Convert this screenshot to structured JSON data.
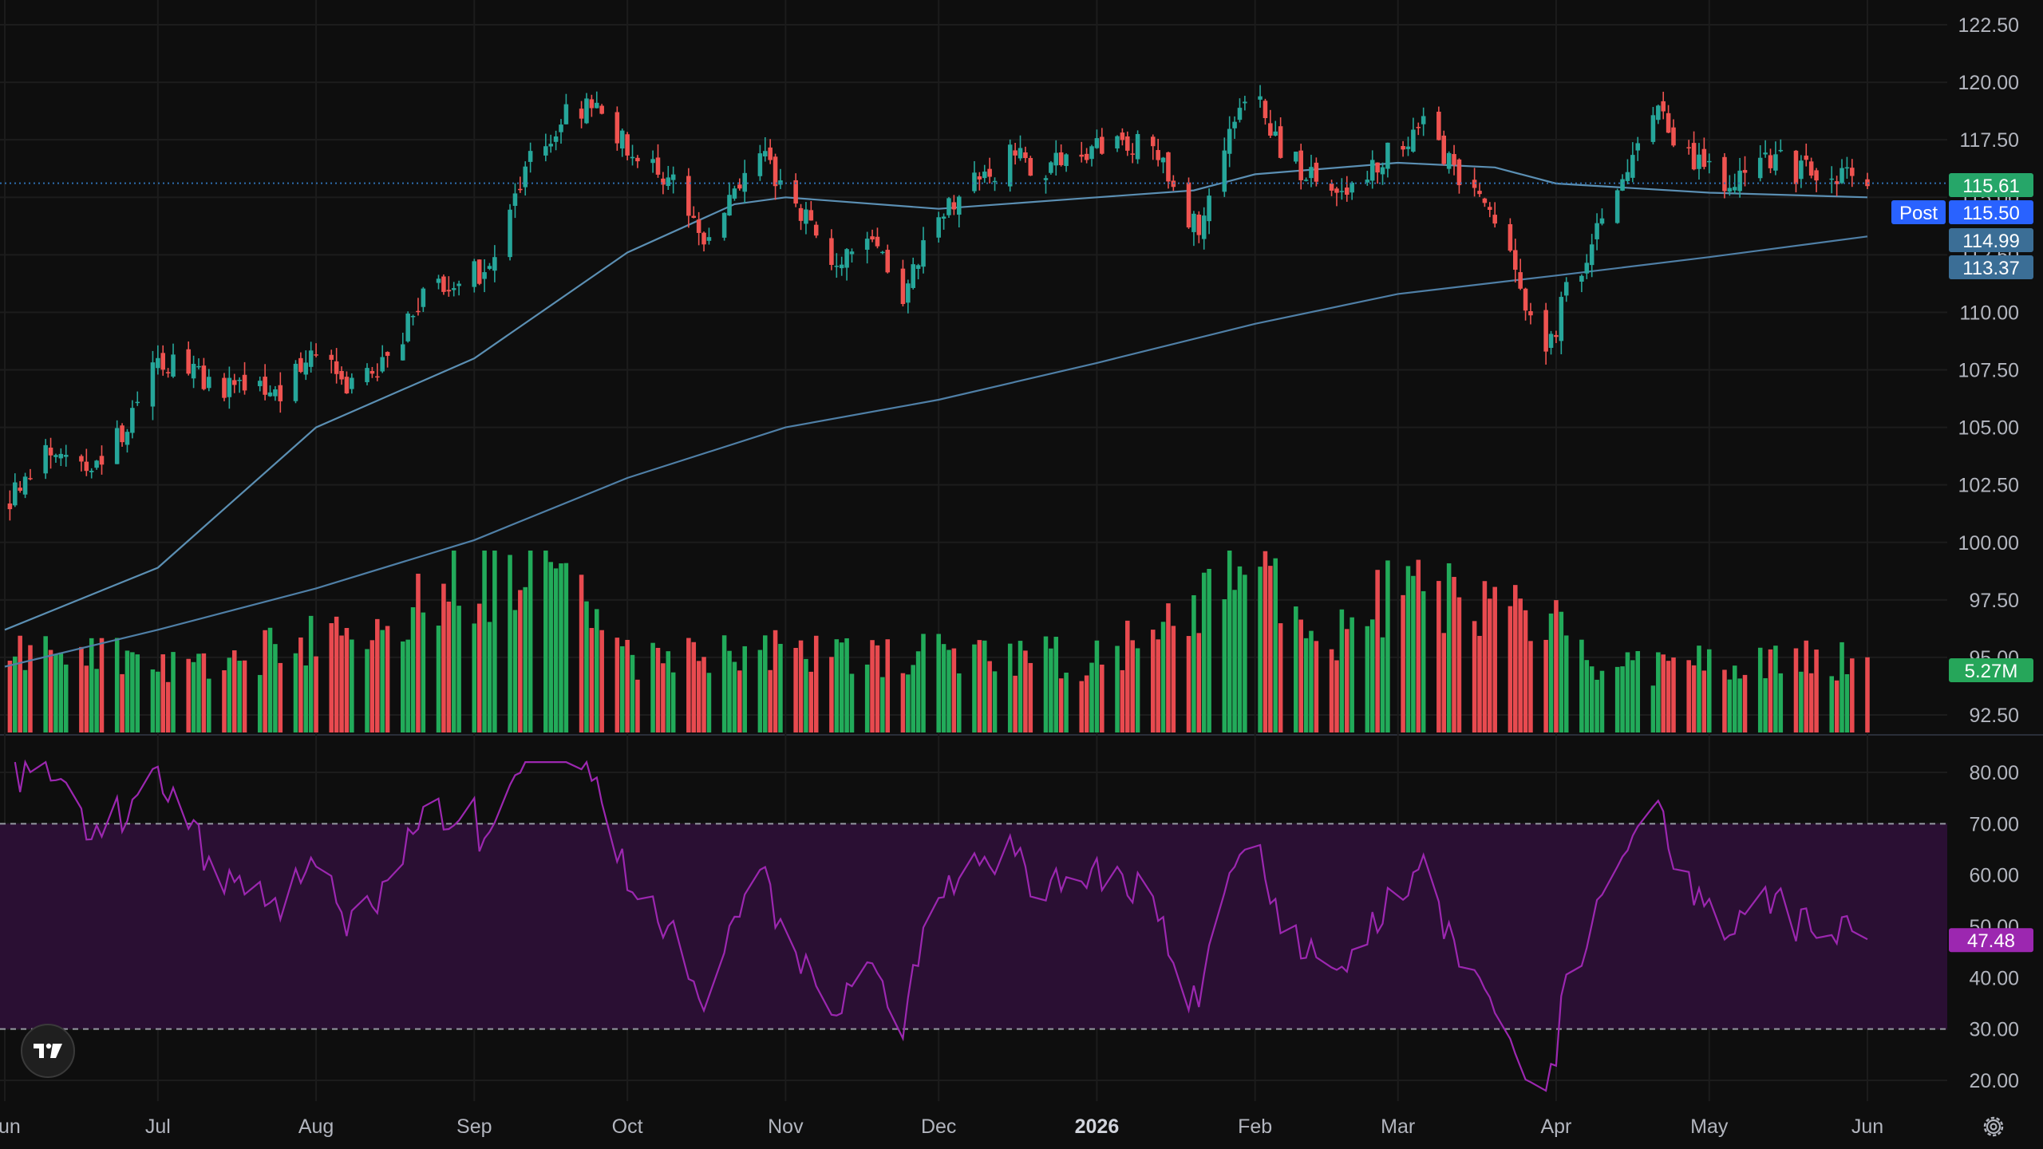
{
  "chart_data": [
    {
      "type": "candlestick",
      "panel": "price",
      "y_axis_ticks": [
        "122.50",
        "120.00",
        "117.50",
        "115.00",
        "112.50",
        "110.00",
        "107.50",
        "105.00",
        "102.50",
        "100.00",
        "97.50",
        "95.00",
        "92.50"
      ],
      "ylim": [
        91.8,
        123.5
      ],
      "grid": true,
      "x_axis_labels": [
        "un",
        "Jul",
        "Aug",
        "Sep",
        "Oct",
        "Nov",
        "Dec",
        "2026",
        "Feb",
        "Mar",
        "Apr",
        "May",
        "Jun"
      ],
      "close_anchors": [
        [
          "2025-06-02",
          102.0
        ],
        [
          "2025-06-10",
          104.2
        ],
        [
          "2025-06-18",
          103.5
        ],
        [
          "2025-06-25",
          104.8
        ],
        [
          "2025-07-01",
          108.0
        ],
        [
          "2025-07-08",
          107.3
        ],
        [
          "2025-07-16",
          106.6
        ],
        [
          "2025-07-24",
          106.4
        ],
        [
          "2025-08-01",
          108.1
        ],
        [
          "2025-08-08",
          106.7
        ],
        [
          "2025-08-15",
          107.8
        ],
        [
          "2025-08-22",
          110.7
        ],
        [
          "2025-08-29",
          111.2
        ],
        [
          "2025-09-05",
          112.3
        ],
        [
          "2025-09-12",
          116.5
        ],
        [
          "2025-09-18",
          118.5
        ],
        [
          "2025-09-25",
          118.8
        ],
        [
          "2025-10-03",
          116.6
        ],
        [
          "2025-10-10",
          115.5
        ],
        [
          "2025-10-16",
          113.2
        ],
        [
          "2025-10-22",
          115.6
        ],
        [
          "2025-10-28",
          116.8
        ],
        [
          "2025-11-03",
          114.5
        ],
        [
          "2025-11-10",
          112.4
        ],
        [
          "2025-11-17",
          113.2
        ],
        [
          "2025-11-24",
          110.6
        ],
        [
          "2025-12-01",
          114.2
        ],
        [
          "2025-12-08",
          115.6
        ],
        [
          "2025-12-15",
          116.8
        ],
        [
          "2025-12-22",
          116.3
        ],
        [
          "2025-12-29",
          116.9
        ],
        [
          "2026-01-05",
          117.6
        ],
        [
          "2026-01-12",
          117.2
        ],
        [
          "2026-01-16",
          115.2
        ],
        [
          "2026-01-21",
          113.6
        ],
        [
          "2026-01-26",
          117.6
        ],
        [
          "2026-02-01",
          119.5
        ],
        [
          "2026-02-06",
          117.0
        ],
        [
          "2026-02-12",
          116.0
        ],
        [
          "2026-02-18",
          114.8
        ],
        [
          "2026-02-25",
          116.6
        ],
        [
          "2026-03-03",
          117.5
        ],
        [
          "2026-03-06",
          118.3
        ],
        [
          "2026-03-12",
          116.4
        ],
        [
          "2026-03-18",
          114.5
        ],
        [
          "2026-03-24",
          111.8
        ],
        [
          "2026-03-30",
          107.9
        ],
        [
          "2026-04-03",
          110.8
        ],
        [
          "2026-04-09",
          113.4
        ],
        [
          "2026-04-15",
          116.0
        ],
        [
          "2026-04-21",
          119.0
        ],
        [
          "2026-04-27",
          116.7
        ],
        [
          "2026-05-04",
          115.6
        ],
        [
          "2026-05-11",
          117.0
        ],
        [
          "2026-05-18",
          116.1
        ],
        [
          "2026-05-25",
          116.2
        ],
        [
          "2026-06-01",
          115.5
        ]
      ],
      "moving_averages": [
        {
          "period": 50,
          "color": "#5b8fb3",
          "points": [
            [
              "2025-06-01",
              96.2
            ],
            [
              "2025-07-01",
              98.9
            ],
            [
              "2025-08-01",
              105.0
            ],
            [
              "2025-09-01",
              108.0
            ],
            [
              "2025-10-01",
              112.6
            ],
            [
              "2025-10-22",
              114.7
            ],
            [
              "2025-11-01",
              115.0
            ],
            [
              "2025-12-01",
              114.5
            ],
            [
              "2026-01-01",
              115.0
            ],
            [
              "2026-01-20",
              115.3
            ],
            [
              "2026-02-01",
              116.0
            ],
            [
              "2026-03-01",
              116.5
            ],
            [
              "2026-03-20",
              116.3
            ],
            [
              "2026-04-01",
              115.6
            ],
            [
              "2026-05-01",
              115.2
            ],
            [
              "2026-06-01",
              115.0
            ]
          ]
        },
        {
          "period": 200,
          "color": "#4f7fa6",
          "points": [
            [
              "2025-06-01",
              94.6
            ],
            [
              "2025-07-01",
              96.2
            ],
            [
              "2025-08-01",
              98.0
            ],
            [
              "2025-09-01",
              100.1
            ],
            [
              "2025-10-01",
              102.8
            ],
            [
              "2025-11-01",
              105.0
            ],
            [
              "2025-12-01",
              106.2
            ],
            [
              "2026-01-01",
              107.8
            ],
            [
              "2026-02-01",
              109.5
            ],
            [
              "2026-03-01",
              110.8
            ],
            [
              "2026-04-01",
              111.6
            ],
            [
              "2026-05-01",
              112.4
            ],
            [
              "2026-06-01",
              113.3
            ]
          ]
        }
      ],
      "price_labels": [
        {
          "text": "115.61",
          "value": 115.61,
          "kind": "last",
          "color": "#26a669"
        },
        {
          "text": "115.50",
          "value": 115.5,
          "kind": "post",
          "color": "#2962ff",
          "tag": "Post"
        },
        {
          "text": "114.99",
          "value": 114.99,
          "kind": "ma50",
          "color": "#3b6e96"
        },
        {
          "text": "113.37",
          "value": 113.37,
          "kind": "ma200",
          "color": "#3b6e96"
        }
      ],
      "up_color": "#26a69a",
      "down_color": "#ef5350"
    },
    {
      "type": "bar",
      "panel": "volume",
      "last_volume_label": "5.27M",
      "label_color": "#26a65a",
      "relative_volume_note": "bar heights relative (0-1) to the tallest bar",
      "relative_volume_anchors": [
        [
          "2025-06-02",
          0.42
        ],
        [
          "2025-07-15",
          0.38
        ],
        [
          "2025-08-12",
          0.62
        ],
        [
          "2025-09-15",
          0.95
        ],
        [
          "2025-10-01",
          0.4
        ],
        [
          "2025-11-01",
          0.45
        ],
        [
          "2025-12-01",
          0.42
        ],
        [
          "2026-01-01",
          0.4
        ],
        [
          "2026-01-20",
          0.7
        ],
        [
          "2026-02-01",
          0.92
        ],
        [
          "2026-02-15",
          0.45
        ],
        [
          "2026-03-01",
          0.8
        ],
        [
          "2026-03-20",
          0.72
        ],
        [
          "2026-04-01",
          0.6
        ],
        [
          "2026-04-10",
          0.33
        ],
        [
          "2026-05-01",
          0.4
        ],
        [
          "2026-06-01",
          0.4
        ]
      ]
    },
    {
      "type": "line",
      "panel": "rsi",
      "y_axis_ticks": [
        "80.00",
        "70.00",
        "60.00",
        "50.00",
        "40.00",
        "30.00",
        "20.00"
      ],
      "ylim": [
        17,
        83
      ],
      "overbought": 70,
      "oversold": 30,
      "line_color": "#9c27b0",
      "band_color": "#2a0f33",
      "last_value_label": "47.48",
      "label_color": "#9c27b0"
    }
  ],
  "icons": {
    "logo": "tradingview-logo-icon",
    "settings": "gear-icon"
  }
}
